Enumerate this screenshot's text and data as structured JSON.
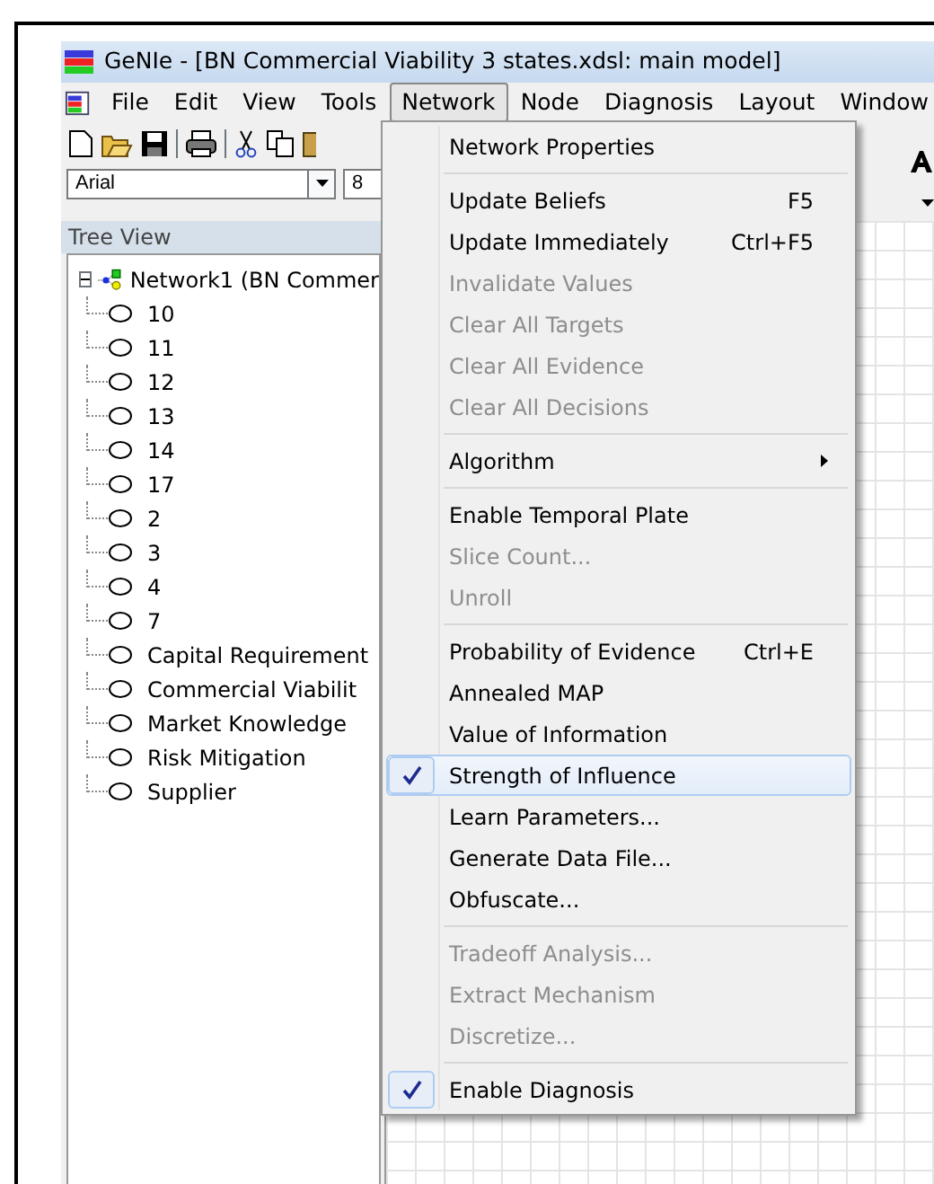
{
  "window": {
    "title": "GeNIe - [BN Commercial Viability 3 states.xdsl: main model]"
  },
  "menu_bar": [
    {
      "label": "File",
      "selected": false
    },
    {
      "label": "Edit",
      "selected": false
    },
    {
      "label": "View",
      "selected": false
    },
    {
      "label": "Tools",
      "selected": false
    },
    {
      "label": "Network",
      "selected": true
    },
    {
      "label": "Node",
      "selected": false
    },
    {
      "label": "Diagnosis",
      "selected": false
    },
    {
      "label": "Layout",
      "selected": false
    },
    {
      "label": "Window",
      "selected": false
    }
  ],
  "format_bar": {
    "font": "Arial",
    "size": "8"
  },
  "tree_view": {
    "title": "Tree View",
    "root": {
      "label": "Network1 (BN Commer",
      "expanded": true,
      "children": [
        {
          "label": "10"
        },
        {
          "label": "11"
        },
        {
          "label": "12"
        },
        {
          "label": "13"
        },
        {
          "label": "14"
        },
        {
          "label": "17"
        },
        {
          "label": "2"
        },
        {
          "label": "3"
        },
        {
          "label": "4"
        },
        {
          "label": "7"
        },
        {
          "label": "Capital Requirement"
        },
        {
          "label": "Commercial Viabilit"
        },
        {
          "label": "Market Knowledge"
        },
        {
          "label": "Risk Mitigation"
        },
        {
          "label": "Supplier"
        }
      ]
    }
  },
  "network_menu": [
    {
      "kind": "item",
      "label": "Network Properties",
      "disabled": false,
      "checked": false,
      "selected": false
    },
    {
      "kind": "separator"
    },
    {
      "kind": "item",
      "label": "Update Beliefs",
      "shortcut": "F5",
      "disabled": false,
      "checked": false,
      "selected": false
    },
    {
      "kind": "item",
      "label": "Update Immediately",
      "shortcut": "Ctrl+F5",
      "disabled": false,
      "checked": false,
      "selected": false
    },
    {
      "kind": "item",
      "label": "Invalidate Values",
      "disabled": true,
      "checked": false,
      "selected": false
    },
    {
      "kind": "item",
      "label": "Clear All Targets",
      "disabled": true,
      "checked": false,
      "selected": false
    },
    {
      "kind": "item",
      "label": "Clear All Evidence",
      "disabled": true,
      "checked": false,
      "selected": false
    },
    {
      "kind": "item",
      "label": "Clear All Decisions",
      "disabled": true,
      "checked": false,
      "selected": false
    },
    {
      "kind": "separator"
    },
    {
      "kind": "submenu",
      "label": "Algorithm",
      "disabled": false,
      "checked": false,
      "selected": false
    },
    {
      "kind": "separator"
    },
    {
      "kind": "item",
      "label": "Enable Temporal Plate",
      "disabled": false,
      "checked": false,
      "selected": false
    },
    {
      "kind": "item",
      "label": "Slice Count...",
      "disabled": true,
      "checked": false,
      "selected": false
    },
    {
      "kind": "item",
      "label": "Unroll",
      "disabled": true,
      "checked": false,
      "selected": false
    },
    {
      "kind": "separator"
    },
    {
      "kind": "item",
      "label": "Probability of Evidence",
      "shortcut": "Ctrl+E",
      "disabled": false,
      "checked": false,
      "selected": false
    },
    {
      "kind": "item",
      "label": "Annealed MAP",
      "disabled": false,
      "checked": false,
      "selected": false
    },
    {
      "kind": "item",
      "label": "Value of Information",
      "disabled": false,
      "checked": false,
      "selected": false
    },
    {
      "kind": "item",
      "label": "Strength of Influence",
      "disabled": false,
      "checked": true,
      "selected": true
    },
    {
      "kind": "item",
      "label": "Learn Parameters...",
      "disabled": false,
      "checked": false,
      "selected": false
    },
    {
      "kind": "item",
      "label": "Generate Data File...",
      "disabled": false,
      "checked": false,
      "selected": false
    },
    {
      "kind": "item",
      "label": "Obfuscate...",
      "disabled": false,
      "checked": false,
      "selected": false
    },
    {
      "kind": "separator"
    },
    {
      "kind": "item",
      "label": "Tradeoff Analysis...",
      "disabled": true,
      "checked": false,
      "selected": false
    },
    {
      "kind": "item",
      "label": "Extract Mechanism",
      "disabled": true,
      "checked": false,
      "selected": false
    },
    {
      "kind": "item",
      "label": "Discretize...",
      "disabled": true,
      "checked": false,
      "selected": false
    },
    {
      "kind": "separator"
    },
    {
      "kind": "item",
      "label": "Enable Diagnosis",
      "disabled": false,
      "checked": true,
      "selected": false
    }
  ]
}
